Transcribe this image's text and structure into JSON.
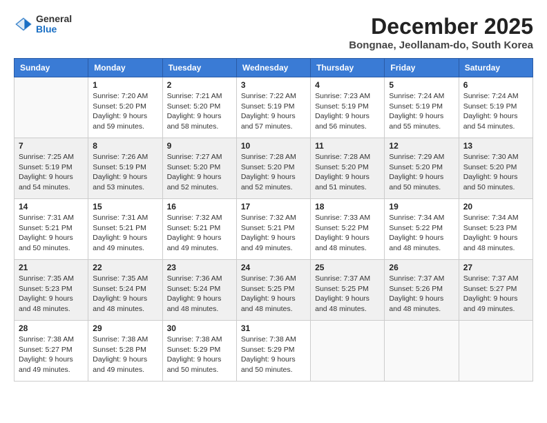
{
  "logo": {
    "general": "General",
    "blue": "Blue"
  },
  "title": "December 2025",
  "location": "Bongnae, Jeollanam-do, South Korea",
  "days_of_week": [
    "Sunday",
    "Monday",
    "Tuesday",
    "Wednesday",
    "Thursday",
    "Friday",
    "Saturday"
  ],
  "weeks": [
    [
      {
        "day": "",
        "info": ""
      },
      {
        "day": "1",
        "info": "Sunrise: 7:20 AM\nSunset: 5:20 PM\nDaylight: 9 hours\nand 59 minutes."
      },
      {
        "day": "2",
        "info": "Sunrise: 7:21 AM\nSunset: 5:20 PM\nDaylight: 9 hours\nand 58 minutes."
      },
      {
        "day": "3",
        "info": "Sunrise: 7:22 AM\nSunset: 5:19 PM\nDaylight: 9 hours\nand 57 minutes."
      },
      {
        "day": "4",
        "info": "Sunrise: 7:23 AM\nSunset: 5:19 PM\nDaylight: 9 hours\nand 56 minutes."
      },
      {
        "day": "5",
        "info": "Sunrise: 7:24 AM\nSunset: 5:19 PM\nDaylight: 9 hours\nand 55 minutes."
      },
      {
        "day": "6",
        "info": "Sunrise: 7:24 AM\nSunset: 5:19 PM\nDaylight: 9 hours\nand 54 minutes."
      }
    ],
    [
      {
        "day": "7",
        "info": "Sunrise: 7:25 AM\nSunset: 5:19 PM\nDaylight: 9 hours\nand 54 minutes."
      },
      {
        "day": "8",
        "info": "Sunrise: 7:26 AM\nSunset: 5:19 PM\nDaylight: 9 hours\nand 53 minutes."
      },
      {
        "day": "9",
        "info": "Sunrise: 7:27 AM\nSunset: 5:20 PM\nDaylight: 9 hours\nand 52 minutes."
      },
      {
        "day": "10",
        "info": "Sunrise: 7:28 AM\nSunset: 5:20 PM\nDaylight: 9 hours\nand 52 minutes."
      },
      {
        "day": "11",
        "info": "Sunrise: 7:28 AM\nSunset: 5:20 PM\nDaylight: 9 hours\nand 51 minutes."
      },
      {
        "day": "12",
        "info": "Sunrise: 7:29 AM\nSunset: 5:20 PM\nDaylight: 9 hours\nand 50 minutes."
      },
      {
        "day": "13",
        "info": "Sunrise: 7:30 AM\nSunset: 5:20 PM\nDaylight: 9 hours\nand 50 minutes."
      }
    ],
    [
      {
        "day": "14",
        "info": "Sunrise: 7:31 AM\nSunset: 5:21 PM\nDaylight: 9 hours\nand 50 minutes."
      },
      {
        "day": "15",
        "info": "Sunrise: 7:31 AM\nSunset: 5:21 PM\nDaylight: 9 hours\nand 49 minutes."
      },
      {
        "day": "16",
        "info": "Sunrise: 7:32 AM\nSunset: 5:21 PM\nDaylight: 9 hours\nand 49 minutes."
      },
      {
        "day": "17",
        "info": "Sunrise: 7:32 AM\nSunset: 5:21 PM\nDaylight: 9 hours\nand 49 minutes."
      },
      {
        "day": "18",
        "info": "Sunrise: 7:33 AM\nSunset: 5:22 PM\nDaylight: 9 hours\nand 48 minutes."
      },
      {
        "day": "19",
        "info": "Sunrise: 7:34 AM\nSunset: 5:22 PM\nDaylight: 9 hours\nand 48 minutes."
      },
      {
        "day": "20",
        "info": "Sunrise: 7:34 AM\nSunset: 5:23 PM\nDaylight: 9 hours\nand 48 minutes."
      }
    ],
    [
      {
        "day": "21",
        "info": "Sunrise: 7:35 AM\nSunset: 5:23 PM\nDaylight: 9 hours\nand 48 minutes."
      },
      {
        "day": "22",
        "info": "Sunrise: 7:35 AM\nSunset: 5:24 PM\nDaylight: 9 hours\nand 48 minutes."
      },
      {
        "day": "23",
        "info": "Sunrise: 7:36 AM\nSunset: 5:24 PM\nDaylight: 9 hours\nand 48 minutes."
      },
      {
        "day": "24",
        "info": "Sunrise: 7:36 AM\nSunset: 5:25 PM\nDaylight: 9 hours\nand 48 minutes."
      },
      {
        "day": "25",
        "info": "Sunrise: 7:37 AM\nSunset: 5:25 PM\nDaylight: 9 hours\nand 48 minutes."
      },
      {
        "day": "26",
        "info": "Sunrise: 7:37 AM\nSunset: 5:26 PM\nDaylight: 9 hours\nand 48 minutes."
      },
      {
        "day": "27",
        "info": "Sunrise: 7:37 AM\nSunset: 5:27 PM\nDaylight: 9 hours\nand 49 minutes."
      }
    ],
    [
      {
        "day": "28",
        "info": "Sunrise: 7:38 AM\nSunset: 5:27 PM\nDaylight: 9 hours\nand 49 minutes."
      },
      {
        "day": "29",
        "info": "Sunrise: 7:38 AM\nSunset: 5:28 PM\nDaylight: 9 hours\nand 49 minutes."
      },
      {
        "day": "30",
        "info": "Sunrise: 7:38 AM\nSunset: 5:29 PM\nDaylight: 9 hours\nand 50 minutes."
      },
      {
        "day": "31",
        "info": "Sunrise: 7:38 AM\nSunset: 5:29 PM\nDaylight: 9 hours\nand 50 minutes."
      },
      {
        "day": "",
        "info": ""
      },
      {
        "day": "",
        "info": ""
      },
      {
        "day": "",
        "info": ""
      }
    ]
  ]
}
